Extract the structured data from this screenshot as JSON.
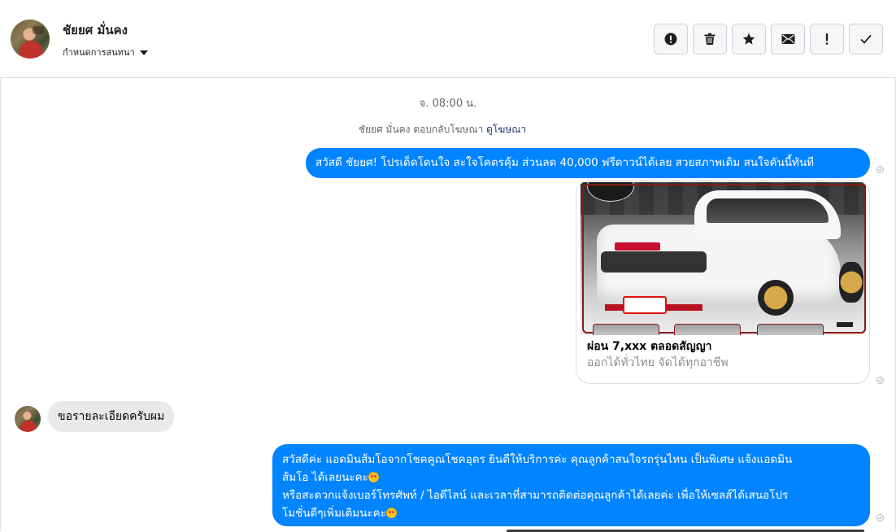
{
  "header": {
    "contact_name": "ชัยยศ มั่นคง",
    "assign_label": "กำหนดการสนทนา",
    "toolbar": [
      {
        "name": "report-spam-button",
        "icon": "alert-circle-icon"
      },
      {
        "name": "delete-button",
        "icon": "trash-icon"
      },
      {
        "name": "star-button",
        "icon": "star-icon"
      },
      {
        "name": "mark-unread-button",
        "icon": "envelope-icon"
      },
      {
        "name": "follow-up-button",
        "icon": "exclamation-icon"
      },
      {
        "name": "mark-done-button",
        "icon": "check-icon"
      }
    ]
  },
  "conversation": {
    "timestamp": "จ. 08:00 น.",
    "ad_reply_text": "ชัยยศ มั่นคง ตอบกลับโฆษณา",
    "ad_reply_link": "ดูโฆษณา",
    "messages": [
      {
        "direction": "outgoing",
        "text": "สวัสดี ชัยยศ! โปรเด็ดโดนใจ สะใจโคตรคุ้ม ส่วนลด 40,000 ฟรีดาวน์ได้เลย สวยสภาพเดิม สนใจคันนี้ทันที"
      },
      {
        "direction": "outgoing",
        "type": "ad_card",
        "title": "ผ่อน 7,xxx ตลอดสัญญา",
        "subtitle": "ออกได้ทั่วไทย จัดได้ทุกอาชีพ"
      },
      {
        "direction": "incoming",
        "text": "ขอรายละเอียดครับผม"
      },
      {
        "direction": "outgoing",
        "lines": [
          "สวัสดีค่ะ แอดมินส้มโอจากโชคคูณโชคอุดร ยินดีให้บริการค่ะ   คุณลูกค้าสนใจรถรุ่นไหน เป็นพิเศษ แจ้งแอดมิน",
          "ส้มโอ ได้เลยนะคะ",
          "หรือสะดวกแจ้งเบอร์โทรศัพท์ / ไอดีไลน์ และเวลาที่สามารถติดต่อคุณลูกค้าได้เลยค่ะ เพื่อให้เซลส์ได้เสนอโปร",
          "โมชั่นดีๆเพิ่มเติมนะคะ"
        ]
      }
    ]
  },
  "colors": {
    "outgoing_bubble": "#0084ff",
    "incoming_bubble": "#e9e9ec",
    "header_border": "#dadde1",
    "muted_text": "#65676b"
  }
}
